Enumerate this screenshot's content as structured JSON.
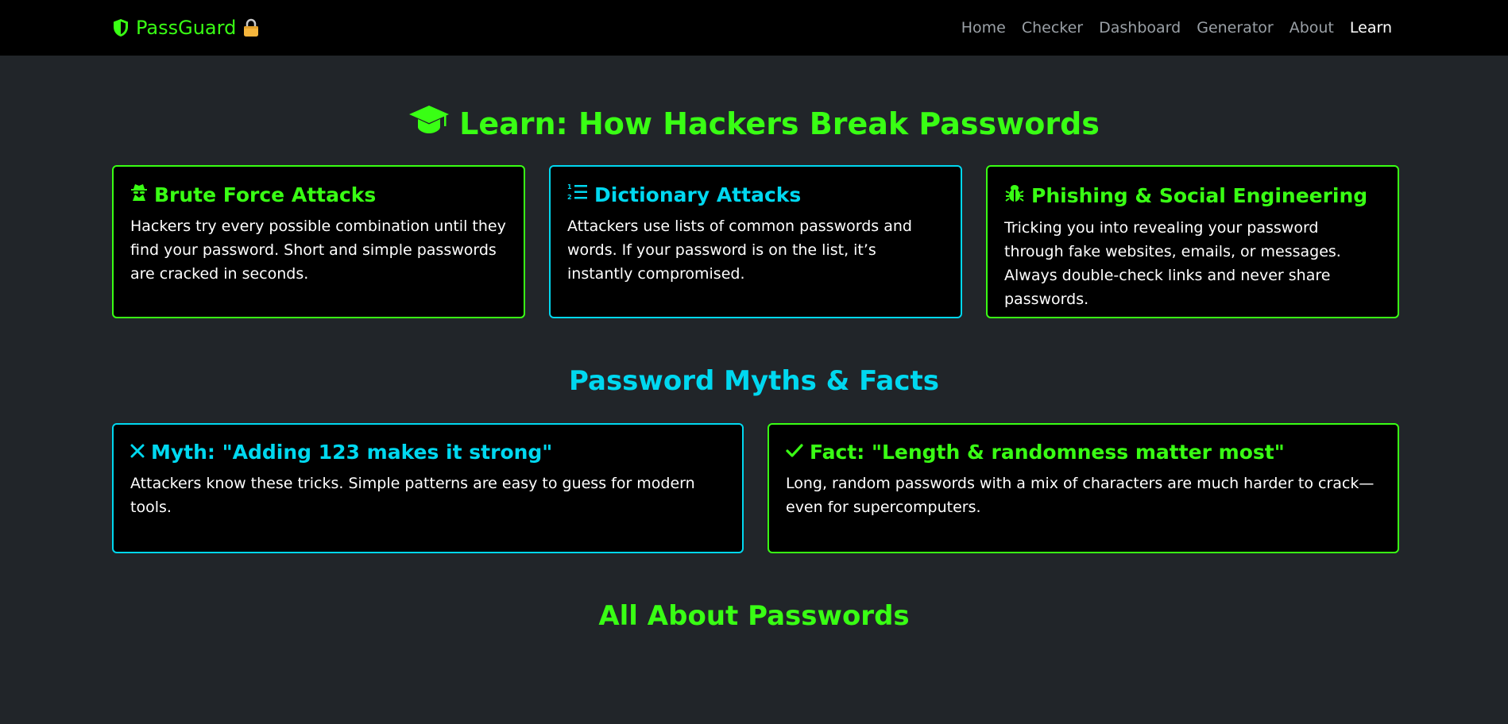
{
  "nav": {
    "brand": "PassGuard",
    "links": [
      "Home",
      "Checker",
      "Dashboard",
      "Generator",
      "About",
      "Learn"
    ],
    "active": "Learn"
  },
  "learn": {
    "title": "Learn: How Hackers Break Passwords",
    "cards": [
      {
        "title": "Brute Force Attacks",
        "text": "Hackers try every possible combination until they find your password. Short and simple passwords are cracked in seconds."
      },
      {
        "title": "Dictionary Attacks",
        "text": "Attackers use lists of common passwords and words. If your password is on the list, it’s instantly compromised."
      },
      {
        "title": "Phishing & Social Engineering",
        "text": "Tricking you into revealing your password through fake websites, emails, or messages. Always double-check links and never share passwords."
      }
    ]
  },
  "myths": {
    "title": "Password Myths & Facts",
    "myth": {
      "title": "Myth: \"Adding 123 makes it strong\"",
      "text": "Attackers know these tricks. Simple patterns are easy to guess for modern tools."
    },
    "fact": {
      "title": "Fact: \"Length & randomness matter most\"",
      "text": "Long, random passwords with a mix of characters are much harder to crack—even for supercomputers."
    }
  },
  "about": {
    "title": "All About Passwords"
  },
  "colors": {
    "accent_green": "#39ff14",
    "accent_cyan": "#00d8f0",
    "bg": "#212529",
    "nav_bg": "#000000"
  }
}
